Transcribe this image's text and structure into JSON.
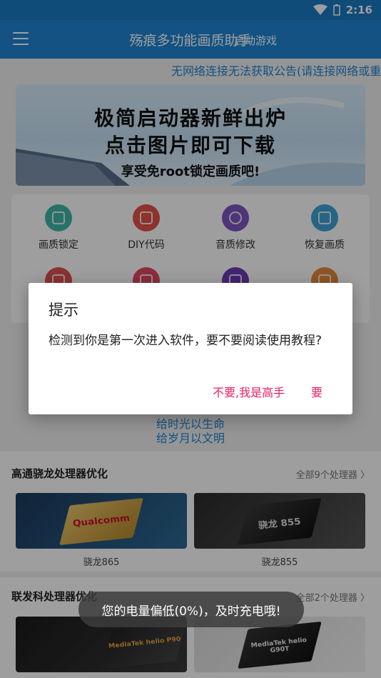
{
  "status": {
    "time": "2:16"
  },
  "app": {
    "title": "殇痕多功能画质助手",
    "subtitle": "启动游戏"
  },
  "notice": "无网络连接无法获取公告(请连接网络或重",
  "banner": {
    "line1": "极简启动器新鲜出炉",
    "line2": "点击图片即可下载",
    "line3": "享受免root锁定画质吧!"
  },
  "grid": [
    {
      "label": "画质锁定",
      "color": "#3fb8a8",
      "icon": "lock-quality-icon"
    },
    {
      "label": "DIY代码",
      "color": "#e4524a",
      "icon": "code-icon"
    },
    {
      "label": "音质修改",
      "color": "#7d56c2",
      "icon": "audio-icon"
    },
    {
      "label": "恢复画质",
      "color": "#3ea3d6",
      "icon": "restore-icon"
    },
    {
      "label": "",
      "color": "#e05050",
      "icon": "gift-icon"
    },
    {
      "label": "",
      "color": "#e04a62",
      "icon": "tools-icon"
    },
    {
      "label": "",
      "color": "#6f3bb6",
      "icon": "flag-icon"
    },
    {
      "label": "",
      "color": "#e7893a",
      "icon": "fire-icon"
    }
  ],
  "slogan": {
    "line1": "给时光以生命",
    "line2": "给岁月以文明"
  },
  "qualcomm": {
    "title": "高通骁龙处理器优化",
    "more": "全部9个处理器 〉",
    "items": [
      {
        "label": "骁龙865",
        "chip_text": "Qualcomm"
      },
      {
        "label": "骁龙855",
        "chip_text": "骁龙 855"
      }
    ]
  },
  "mediatek": {
    "title": "联发科处理器优化",
    "more": "全部2个处理器 〉",
    "items": [
      {
        "label": "",
        "chip_text": "MediaTek helio P90"
      },
      {
        "label": "",
        "chip_text": "MediaTek helio G90T"
      }
    ]
  },
  "dialog": {
    "title": "提示",
    "message": "检测到你是第一次进入软件，要不要阅读使用教程?",
    "negative": "不要,我是高手",
    "positive": "要"
  },
  "toast": "您的电量偏低(0%)，及时充电哦!"
}
